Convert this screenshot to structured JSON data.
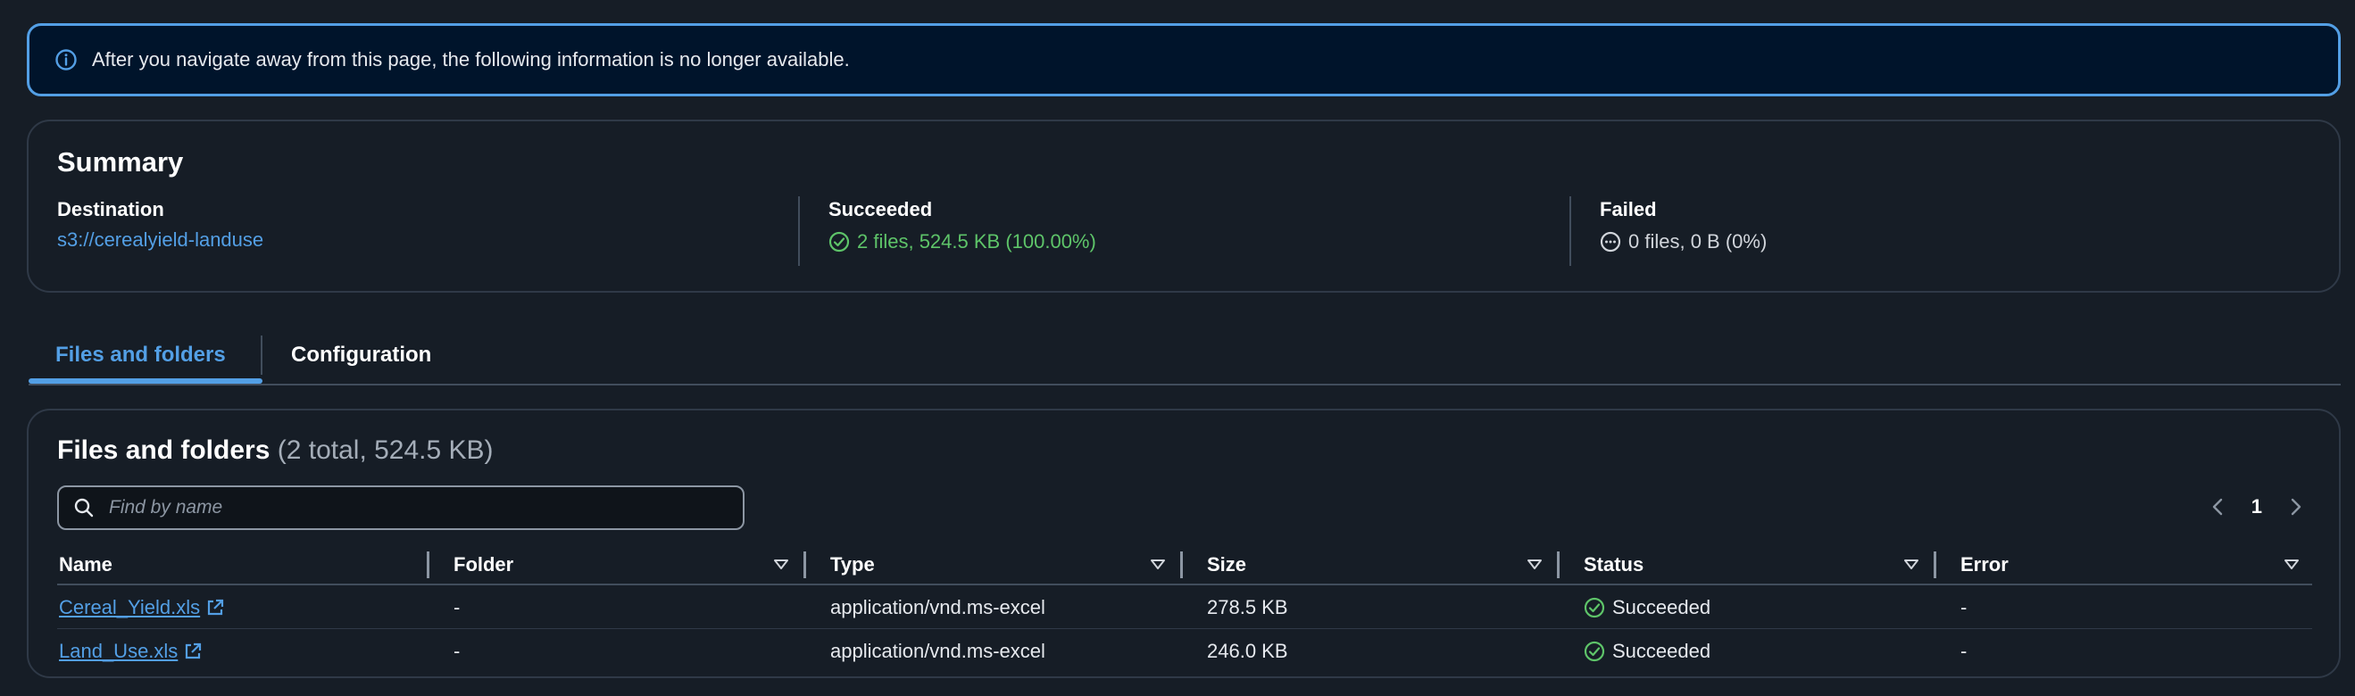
{
  "alert": {
    "text": "After you navigate away from this page, the following information is no longer available."
  },
  "summary": {
    "title": "Summary",
    "destination_label": "Destination",
    "destination_value": "s3://cerealyield-landuse",
    "succeeded_label": "Succeeded",
    "succeeded_value": "2 files, 524.5 KB (100.00%)",
    "failed_label": "Failed",
    "failed_value": "0 files, 0 B (0%)"
  },
  "tabs": [
    {
      "label": "Files and folders",
      "active": true
    },
    {
      "label": "Configuration",
      "active": false
    }
  ],
  "files": {
    "title": "Files and folders",
    "count": "(2 total, 524.5 KB)",
    "search_placeholder": "Find by name",
    "page": "1",
    "columns": [
      "Name",
      "Folder",
      "Type",
      "Size",
      "Status",
      "Error"
    ],
    "rows": [
      {
        "name": "Cereal_Yield.xls",
        "folder": "-",
        "type": "application/vnd.ms-excel",
        "size": "278.5 KB",
        "status": "Succeeded",
        "error": "-"
      },
      {
        "name": "Land_Use.xls",
        "folder": "-",
        "type": "application/vnd.ms-excel",
        "size": "246.0 KB",
        "status": "Succeeded",
        "error": "-"
      }
    ]
  },
  "colors": {
    "accent": "#539fe5",
    "success": "#5ec469",
    "background": "#161d26"
  }
}
